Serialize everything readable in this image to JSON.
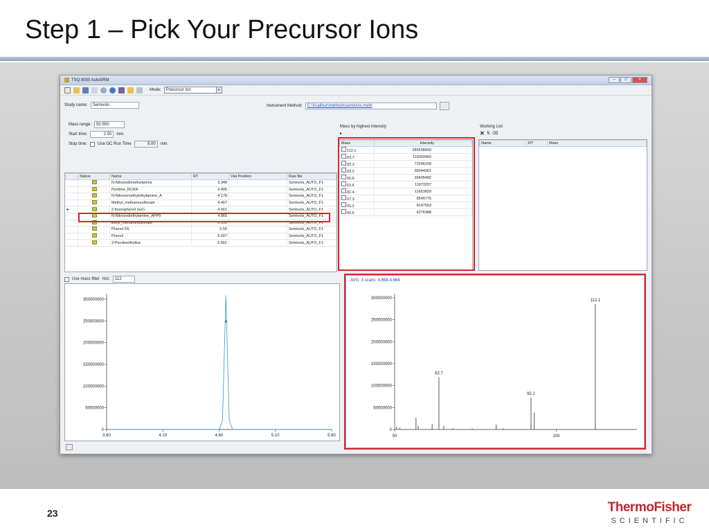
{
  "slide": {
    "title": "Step 1 – Pick Your Precursor Ions",
    "number": "23",
    "logo_line1": "ThermoFisher",
    "logo_line2": "SCIENTIFIC"
  },
  "window": {
    "title": "TSQ 8000 AutoSRM",
    "mode_label": "Mode:",
    "mode_value": "Precursor Ion",
    "study_label": "Study name:",
    "study_value": "Semivols",
    "instrument_label": "Instrument Method:",
    "instrument_value": "C:\\Xcalibur\\methods\\semivols.meth",
    "mass_range_label": "Mass range:",
    "mass_range_value": "50-550",
    "start_label": "Start time:",
    "start_value": "2.50",
    "min1": "min.",
    "stop_label": "Stop time:",
    "use_gc_label": "Use GC Run Time",
    "stop_value": "5.00",
    "min2": "min."
  },
  "compound_table": {
    "headers": [
      "Status",
      "Name",
      "RT",
      "Vial Position",
      "Raw file"
    ],
    "rows": [
      {
        "name": "N-Nitrosodimethylamine",
        "rt": "3.348",
        "raw": "Semivols_AUTO_F1"
      },
      {
        "name": "Pyridine_RCRA",
        "rt": "3.406",
        "raw": "Semivols_AUTO_F1"
      },
      {
        "name": "N-Nitrosomethylethylamine_A",
        "rt": "4.178",
        "raw": "Semivols_AUTO_F1"
      },
      {
        "name": "Methyl_methanesulfonate",
        "rt": "4.467",
        "raw": "Semivols_AUTO_F1"
      },
      {
        "name": "2-fluorophenol (sur)",
        "rt": "4.661",
        "raw": "Semivols_AUTO_F1"
      },
      {
        "name": "N-Nitrosodiethylamine_APP9",
        "rt": "4.865",
        "raw": "Semivols_AUTO_F1"
      },
      {
        "name": "Ethyl_methanesulfonate",
        "rt": "5.151",
        "raw": "Semivols_AUTO_F1"
      },
      {
        "name": "Phenol D6",
        "rt": "5.59",
        "raw": "Semivols_AUTO_F1"
      },
      {
        "name": "Phenol",
        "rt": "5.607",
        "raw": "Semivols_AUTO_F1"
      },
      {
        "name": "2-Picoline/Aniline",
        "rt": "5.661",
        "raw": "Semivols_AUTO_F1"
      }
    ]
  },
  "mass_panel": {
    "title": "Mass by highest intensity",
    "headers": [
      "Mass",
      "Intensity"
    ],
    "rows": [
      {
        "mass": "112.1",
        "intensity": "285508660"
      },
      {
        "mass": "63.7",
        "intensity": "119303960"
      },
      {
        "mass": "92.2",
        "intensity": "72246168"
      },
      {
        "mass": "93.2",
        "intensity": "38344361"
      },
      {
        "mass": "56.6",
        "intensity": "26405482"
      },
      {
        "mass": "61.6",
        "intensity": "11973207"
      },
      {
        "mass": "81.4",
        "intensity": "11653829"
      },
      {
        "mass": "57.3",
        "intensity": "8549775"
      },
      {
        "mass": "65.2",
        "intensity": "8147563"
      },
      {
        "mass": "50.6",
        "intensity": "6276388"
      }
    ]
  },
  "working_list": {
    "title": "Working List",
    "headers": [
      "Name",
      "RT",
      "Mass"
    ]
  },
  "mass_filter": {
    "label": "Use mass filter",
    "mz_label": "m/z:",
    "value": "112"
  },
  "spectrum_label": "AVG: 3 scans: 4.658-4.664",
  "chart_data": [
    {
      "type": "line",
      "title": "",
      "xlabel": "",
      "ylabel": "",
      "xlim": [
        3.6,
        5.6
      ],
      "ylim": [
        0,
        300000000
      ],
      "x_ticks": [
        "3.60",
        "4.10",
        "4.60",
        "5.10",
        "5.60"
      ],
      "y_ticks": [
        "0",
        "50000000",
        "100000000",
        "150000000",
        "200000000",
        "250000000",
        "300000000"
      ],
      "series": [
        {
          "x": [
            3.6,
            4.6,
            4.63,
            4.66,
            4.69,
            4.72,
            5.6
          ],
          "y": [
            0,
            0,
            20000000,
            320000000,
            20000000,
            0,
            0
          ]
        }
      ]
    },
    {
      "type": "bar",
      "title": "",
      "xlabel": "",
      "ylabel": "",
      "xlim": [
        50,
        125
      ],
      "ylim": [
        0,
        300000000
      ],
      "x_ticks": [
        "50",
        "100"
      ],
      "y_ticks": [
        "0",
        "50000000",
        "100000000",
        "150000000",
        "200000000",
        "250000000",
        "300000000"
      ],
      "peaks": [
        {
          "mass": 50.6,
          "intensity": 6276388
        },
        {
          "mass": 51.6,
          "intensity": 4000000
        },
        {
          "mass": 56.6,
          "intensity": 26405482
        },
        {
          "mass": 57.3,
          "intensity": 8549775
        },
        {
          "mass": 61.6,
          "intensity": 11973207
        },
        {
          "mass": 63.7,
          "intensity": 119303960
        },
        {
          "mass": 65.2,
          "intensity": 8147563
        },
        {
          "mass": 68.0,
          "intensity": 3000000
        },
        {
          "mass": 74.0,
          "intensity": 2500000
        },
        {
          "mass": 81.4,
          "intensity": 11653829
        },
        {
          "mass": 83.5,
          "intensity": 3000000
        },
        {
          "mass": 92.2,
          "intensity": 72246168
        },
        {
          "mass": 93.2,
          "intensity": 38344361
        },
        {
          "mass": 112.1,
          "intensity": 285508660
        }
      ],
      "peak_labels": [
        "63.7",
        "92.2",
        "112.1"
      ]
    }
  ]
}
